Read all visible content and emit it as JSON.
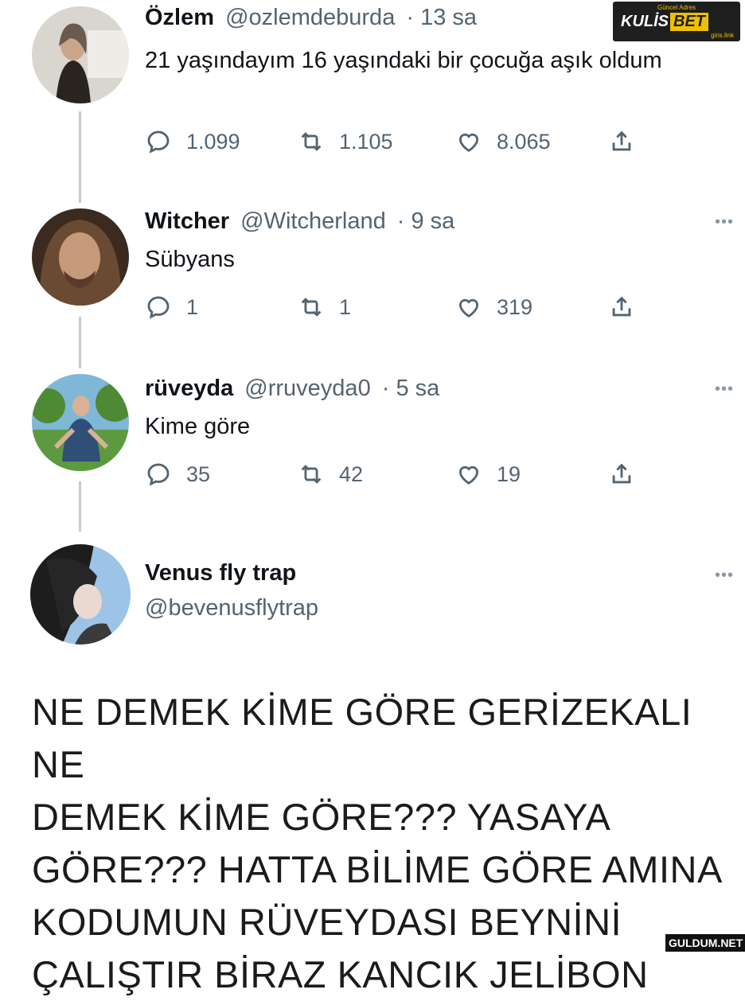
{
  "watermarks": {
    "kulisbet": {
      "top": "Güncel Adres",
      "brand": "KULİS",
      "brand_accent": "BET",
      "link": "giris.link"
    },
    "guldum": "GULDUM.NET"
  },
  "tweets": [
    {
      "name": "Özlem",
      "handle": "@ozlemdeburda",
      "time": "· 13 sa",
      "text": "21 yaşındayım 16 yaşındaki bir çocuğa aşık oldum",
      "replies": "1.099",
      "retweets": "1.105",
      "likes": "8.065",
      "avatar_colors": [
        "#d9d5cf",
        "#6b5a4e"
      ]
    },
    {
      "name": "Witcher",
      "handle": "@Witcherland",
      "time": "· 9 sa",
      "text": "Sübyans",
      "replies": "1",
      "retweets": "1",
      "likes": "319",
      "avatar_colors": [
        "#6b4a33",
        "#c49a7a"
      ]
    },
    {
      "name": "rüveyda",
      "handle": "@rruveyda0",
      "time": "· 5 sa",
      "text": "Kime göre",
      "replies": "35",
      "retweets": "42",
      "likes": "19",
      "avatar_colors": [
        "#5d9a3f",
        "#2f4f77"
      ]
    }
  ],
  "reply": {
    "name": "Venus fly trap",
    "handle": "@bevenusflytrap",
    "text_lines": [
      "NE DEMEK KİME GÖRE GERİZEKALI NE",
      "DEMEK KİME GÖRE??? YASAYA",
      "GÖRE??? HATTA BİLİME GÖRE AMINA",
      "KODUMUN RÜVEYDASI BEYNİNİ",
      "ÇALIŞTIR BİRAZ KANCIK JELİBON"
    ],
    "avatar_colors": [
      "#9dc3e6",
      "#1d1d1d"
    ]
  },
  "colors": {
    "secondary_text": "#536471",
    "thread_line": "#c8ccd0"
  }
}
